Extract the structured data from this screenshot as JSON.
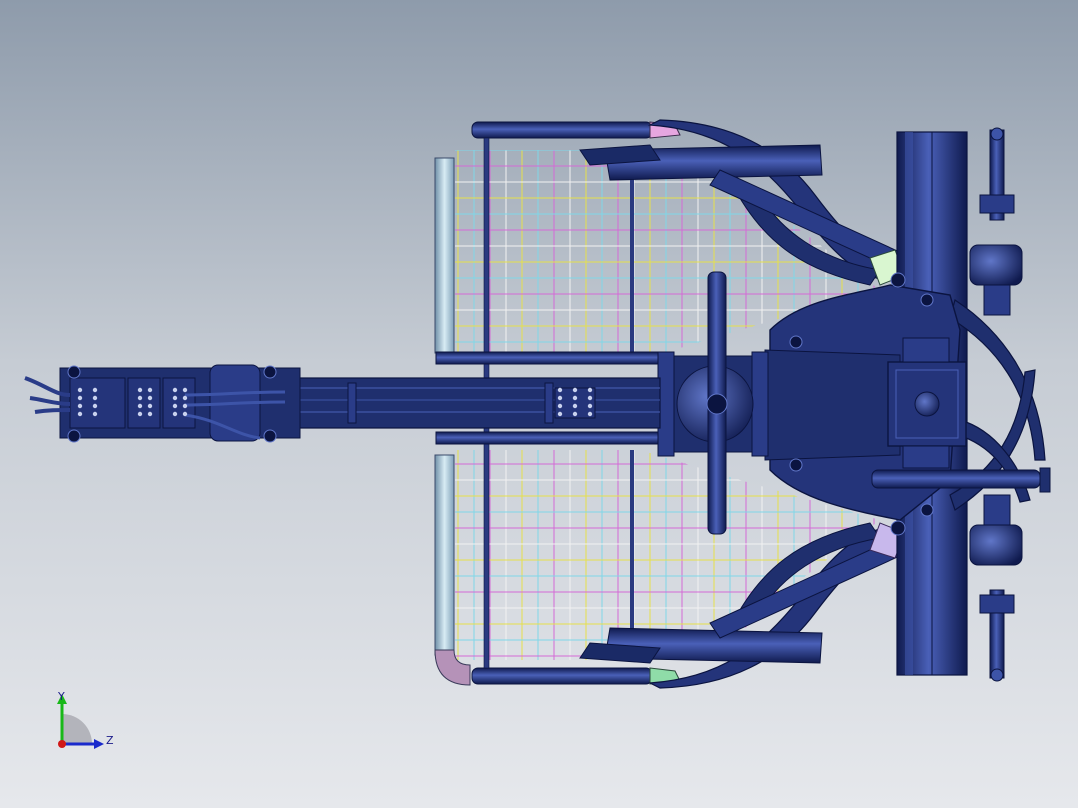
{
  "view": {
    "background_top": "#8e9bab",
    "background_bottom": "#e6e8ec"
  },
  "model": {
    "body_color": "#1f2f6e",
    "highlight_color": "#3d54a8",
    "edge_color": "#0b1440",
    "grid_colors": [
      "#e6e04a",
      "#7fd7e8",
      "#d46ad6",
      "#f2f2f2"
    ]
  },
  "triad": {
    "y_label": "Y",
    "z_label": "Z",
    "y_color": "#18b818",
    "z_color": "#1a2acc",
    "origin_color": "#d01818"
  }
}
